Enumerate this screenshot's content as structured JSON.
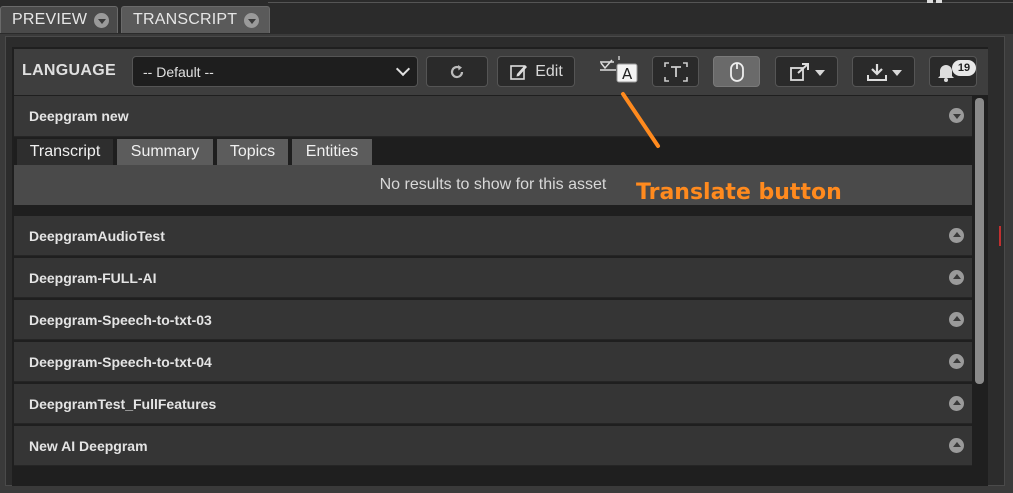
{
  "tabs": [
    {
      "label": "PREVIEW"
    },
    {
      "label": "TRANSCRIPT"
    }
  ],
  "toolbar": {
    "language_label": "LANGUAGE",
    "language_value": "-- Default --",
    "edit_label": "Edit",
    "notifications_count": "19",
    "icons": [
      "refresh-icon",
      "edit-icon",
      "translate-icon",
      "text-recognition-icon",
      "mouse-icon",
      "export-icon",
      "download-icon",
      "bell-icon"
    ]
  },
  "expanded_item": {
    "title": "Deepgram new",
    "subtabs": [
      "Transcript",
      "Summary",
      "Topics",
      "Entities"
    ],
    "active_subtab": "Transcript",
    "empty_message": "No results to show for this asset"
  },
  "items": [
    {
      "title": "DeepgramAudioTest"
    },
    {
      "title": "Deepgram-FULL-AI"
    },
    {
      "title": "Deepgram-Speech-to-txt-03"
    },
    {
      "title": "Deepgram-Speech-to-txt-04"
    },
    {
      "title": "DeepgramTest_FullFeatures"
    },
    {
      "title": "New AI Deepgram"
    }
  ],
  "annotation": {
    "text": "Translate button",
    "color": "#ff8a1e"
  },
  "colors": {
    "background": "#3a3a3a",
    "row": "#353535",
    "accent_annotation": "#ff8a1e"
  }
}
